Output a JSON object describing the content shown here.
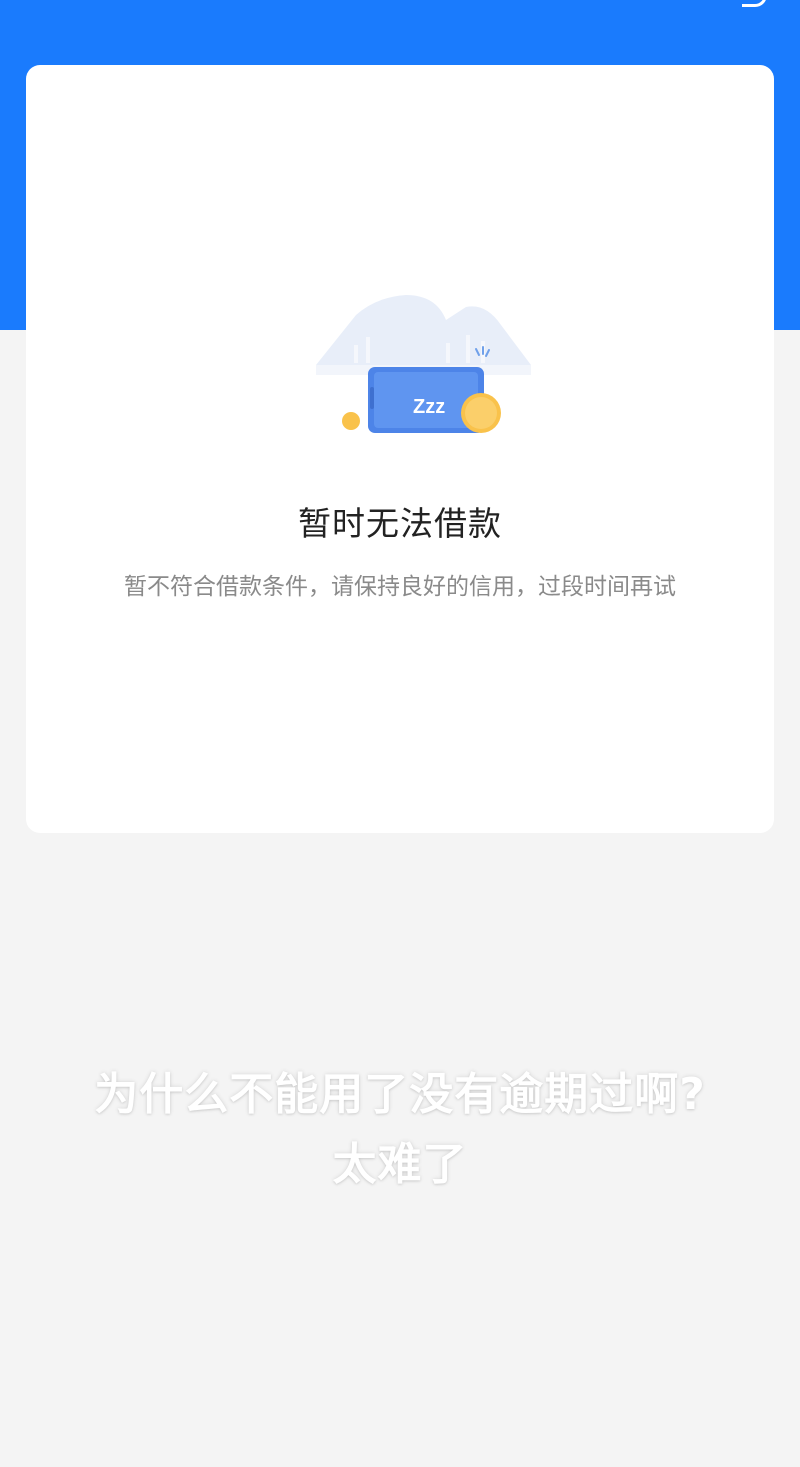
{
  "header": {
    "background_color": "#1a7bfd"
  },
  "card": {
    "illustration_icon": "sleeping-phone-icon",
    "illustration_text": "Zzz",
    "title": "暂时无法借款",
    "subtitle": "暂不符合借款条件，请保持良好的信用，过段时间再试"
  },
  "overlay_caption": {
    "line1": "为什么不能用了没有逾期过啊?",
    "line2": "太难了"
  },
  "colors": {
    "accent": "#1a7bfd",
    "coin": "#f9c24b",
    "page_bg": "#f4f4f4"
  }
}
